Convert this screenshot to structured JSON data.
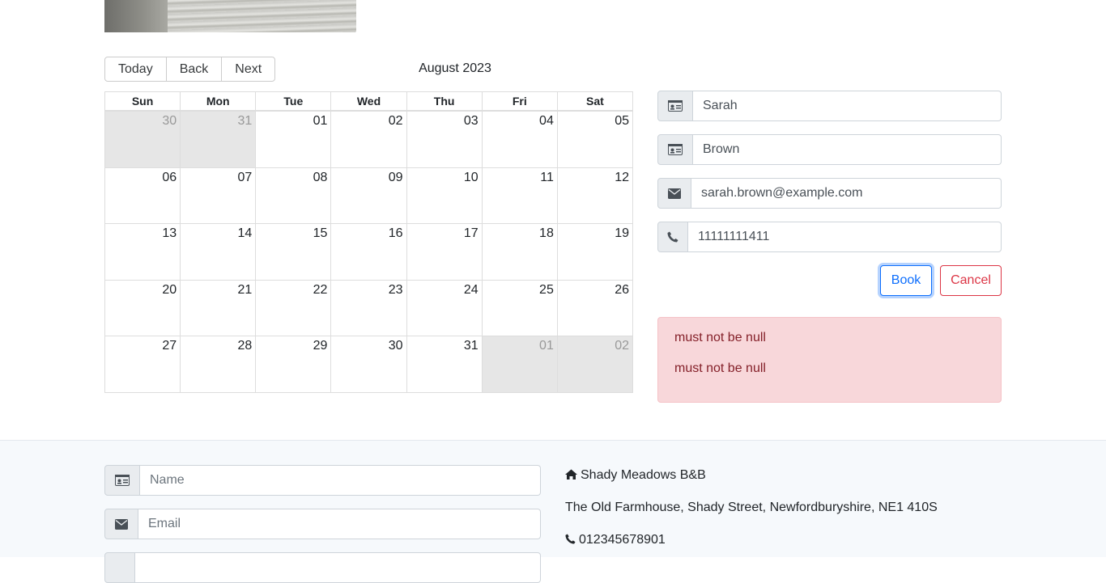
{
  "booking": {
    "calendar": {
      "toolbar": {
        "today": "Today",
        "back": "Back",
        "next": "Next"
      },
      "month_label": "August 2023",
      "weekdays": [
        "Sun",
        "Mon",
        "Tue",
        "Wed",
        "Thu",
        "Fri",
        "Sat"
      ],
      "weeks": [
        [
          "30",
          "31",
          "01",
          "02",
          "03",
          "04",
          "05"
        ],
        [
          "06",
          "07",
          "08",
          "09",
          "10",
          "11",
          "12"
        ],
        [
          "13",
          "14",
          "15",
          "16",
          "17",
          "18",
          "19"
        ],
        [
          "20",
          "21",
          "22",
          "23",
          "24",
          "25",
          "26"
        ],
        [
          "27",
          "28",
          "29",
          "30",
          "31",
          "01",
          "02"
        ]
      ]
    },
    "form": {
      "firstname": "Sarah",
      "lastname": "Brown",
      "email": "sarah.brown@example.com",
      "phone": "11111111411",
      "book_label": "Book",
      "cancel_label": "Cancel"
    },
    "errors": [
      "must not be null",
      "must not be null"
    ]
  },
  "footer": {
    "contact_form": {
      "name_placeholder": "Name",
      "email_placeholder": "Email"
    },
    "contact_info": {
      "name": "Shady Meadows B&B",
      "address": "The Old Farmhouse, Shady Street, Newfordburyshire, NE1 410S",
      "phone": "012345678901"
    }
  },
  "icons": {
    "name": "id-card-icon",
    "email": "envelope-icon",
    "phone": "phone-icon",
    "home": "home-icon"
  },
  "colors": {
    "primary": "#0d6efd",
    "danger": "#dc3545",
    "alert_bg": "#f8d7da",
    "alert_text": "#842029",
    "off_day_bg": "#e6e6e6"
  }
}
